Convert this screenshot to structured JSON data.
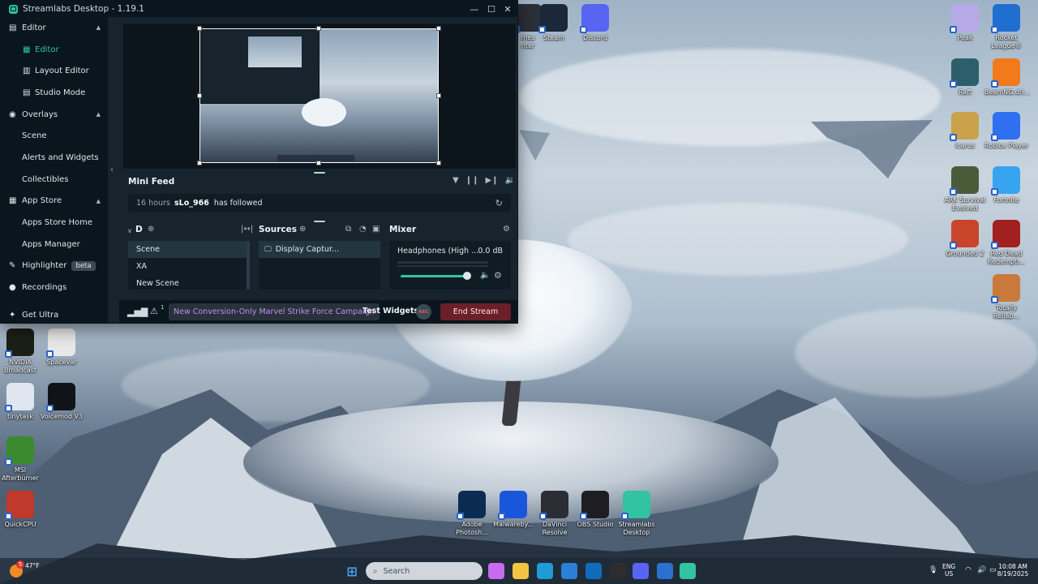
{
  "window": {
    "title": "Streamlabs Desktop - 1.19.1",
    "minimize": "—",
    "maximize": "☐",
    "close": "✕"
  },
  "sidebar": {
    "items": [
      {
        "label": "Editor",
        "kind": "section",
        "icon": "editor-icon",
        "expanded": true
      },
      {
        "label": "Editor",
        "kind": "sub",
        "active": true
      },
      {
        "label": "Layout Editor",
        "kind": "sub"
      },
      {
        "label": "Studio Mode",
        "kind": "sub"
      },
      {
        "label": "Overlays",
        "kind": "section",
        "icon": "overlays-icon",
        "expanded": true
      },
      {
        "label": "Scene",
        "kind": "plain"
      },
      {
        "label": "Alerts and Widgets",
        "kind": "plain"
      },
      {
        "label": "Collectibles",
        "kind": "plain"
      },
      {
        "label": "App Store",
        "kind": "section",
        "icon": "app-store-icon",
        "expanded": true
      },
      {
        "label": "Apps Store Home",
        "kind": "plain"
      },
      {
        "label": "Apps Manager",
        "kind": "plain"
      },
      {
        "label": "Highlighter",
        "kind": "section",
        "icon": "highlighter-icon",
        "badge": "beta"
      },
      {
        "label": "Recordings",
        "kind": "section",
        "icon": "recordings-icon"
      },
      {
        "label": "Get Ultra",
        "kind": "section",
        "icon": "ultra-icon"
      }
    ]
  },
  "mini_feed": {
    "title": "Mini Feed",
    "event": {
      "time": "16 hours",
      "user": "sLo_966",
      "action": "has followed"
    }
  },
  "scenes": {
    "title": "D",
    "items": [
      "Scene",
      "XA",
      "New Scene"
    ],
    "selected": 0
  },
  "sources": {
    "title": "Sources",
    "items": [
      "Display Captur..."
    ]
  },
  "mixer": {
    "title": "Mixer",
    "device": "Headphones (High ...",
    "level": "0.0 dB",
    "volume_fraction": 0.85
  },
  "footer": {
    "warning_count": "1",
    "promo": "New Conversion-Only Marvel Strike Force Campaign",
    "test_widgets": "Test Widgets",
    "rec": "REC",
    "end_stream": "End Stream"
  },
  "desktop_icons": [
    {
      "label": "mes\nnter",
      "icon": "partial-icon",
      "color": "#2a2f38"
    },
    {
      "label": "Steam",
      "icon": "steam-icon",
      "color": "#1b2838"
    },
    {
      "label": "Discord",
      "icon": "discord-icon",
      "color": "#5865f2"
    },
    {
      "label": "Peak",
      "icon": "peak-icon",
      "color": "#b7a8e8"
    },
    {
      "label": "Rocket\nLeague®",
      "icon": "rocket-league-icon",
      "color": "#1f6fd1"
    },
    {
      "label": "Raft",
      "icon": "raft-icon",
      "color": "#2c5f6b"
    },
    {
      "label": "BeamNG.dri...",
      "icon": "beamng-icon",
      "color": "#f07a1c"
    },
    {
      "label": "Icarus",
      "icon": "icarus-icon",
      "color": "#c9a24a"
    },
    {
      "label": "Roblox Player",
      "icon": "roblox-icon",
      "color": "#2f6ff1"
    },
    {
      "label": "ARK Survival\nEvolved",
      "icon": "ark-icon",
      "color": "#4a5b3a"
    },
    {
      "label": "Fortnite",
      "icon": "fortnite-icon",
      "color": "#37a4f0"
    },
    {
      "label": "Grounded 2",
      "icon": "grounded-icon",
      "color": "#c9442a"
    },
    {
      "label": "Red Dead\nRedempti...",
      "icon": "red-dead-icon",
      "color": "#a32020"
    },
    {
      "label": "Totally\nReliab...",
      "icon": "totally-reliable-icon",
      "color": "#c97a3a"
    },
    {
      "label": "NVIDIA\nBroadcast",
      "icon": "nvidia-icon",
      "color": "#1b1f16"
    },
    {
      "label": "Spacevar",
      "icon": "file-icon",
      "color": "#e8e8e8"
    },
    {
      "label": "tinytask",
      "icon": "tinytask-icon",
      "color": "#dfe6ef"
    },
    {
      "label": "Voicemod V3",
      "icon": "voicemod-icon",
      "color": "#101418"
    },
    {
      "label": "MSI\nAfterburner",
      "icon": "msi-afterburner-icon",
      "color": "#3b8a2f"
    },
    {
      "label": "QuickCPU",
      "icon": "quickcpu-icon",
      "color": "#c0392b"
    },
    {
      "label": "Adobe\nPhotosh...",
      "icon": "photoshop-icon",
      "color": "#0b2c52"
    },
    {
      "label": "Malwareby...",
      "icon": "malwarebytes-icon",
      "color": "#1a56db"
    },
    {
      "label": "DaVinci\nResolve",
      "icon": "davinci-icon",
      "color": "#2c2c34"
    },
    {
      "label": "OBS Studio",
      "icon": "obs-icon",
      "color": "#1e1e22"
    },
    {
      "label": "Streamlabs\nDesktop",
      "icon": "streamlabs-icon",
      "color": "#31c3a2"
    }
  ],
  "taskbar": {
    "weather_badge": "5",
    "weather_temp": "47°F\n",
    "search_placeholder": "Search",
    "apps": [
      {
        "icon": "start-icon",
        "color": "#4aa3f0"
      },
      {
        "icon": "copilot-icon",
        "color": "#c86bf0"
      },
      {
        "icon": "file-explorer-icon",
        "color": "#f2c443"
      },
      {
        "icon": "edge-icon",
        "color": "#1f9bd6"
      },
      {
        "icon": "calendar-icon",
        "color": "#2a7fd6"
      },
      {
        "icon": "outlook-icon",
        "color": "#0f6cbd"
      },
      {
        "icon": "capture-icon",
        "color": "#2d2d2d"
      },
      {
        "icon": "discord-icon",
        "color": "#5865f2"
      },
      {
        "icon": "security-icon",
        "color": "#2b6fd1"
      },
      {
        "icon": "streamlabs-icon",
        "color": "#31c3a2"
      }
    ],
    "language": "ENG\nUS",
    "clock_time": "10:08 AM",
    "clock_date": "8/19/2025"
  }
}
